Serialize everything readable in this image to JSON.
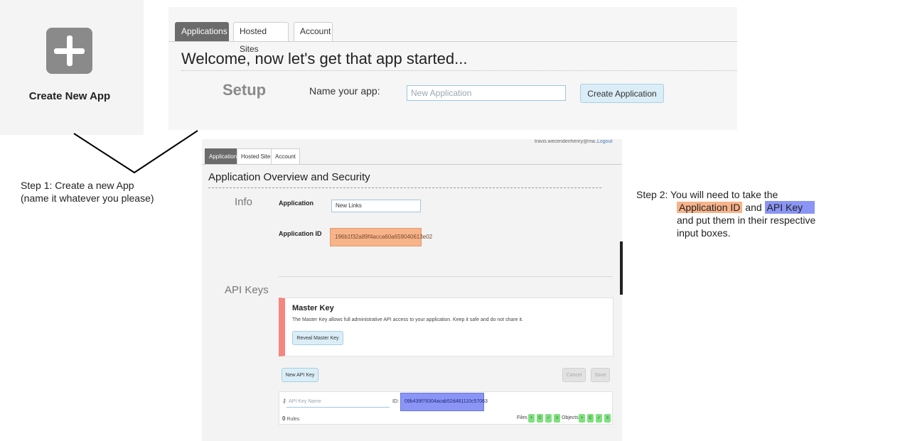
{
  "create_tile": {
    "label": "Create New App",
    "icon": "plus-icon"
  },
  "top_panel": {
    "tabs": [
      "Applications",
      "Hosted Sites",
      "Account"
    ],
    "active_tab": 0,
    "welcome": "Welcome, now let's get that app started...",
    "setup_label": "Setup",
    "name_label": "Name your app:",
    "name_placeholder": "New Application",
    "create_button": "Create Application"
  },
  "step1": {
    "line1": "Step 1: Create a new App",
    "line2": "(name it whatever you please)"
  },
  "step2": {
    "prefix": "Step 2: You will need to take the",
    "app_id": "Application ID",
    "and": "and",
    "api_key": "API Key",
    "line3": "and put them in their respective",
    "line4": "input boxes."
  },
  "second_panel": {
    "user_email": "travis.wecendenhenry@ma...",
    "logout": "Logout",
    "tabs": [
      "Applications",
      "Hosted Sites",
      "Account"
    ],
    "title": "Application Overview and Security",
    "info_label": "Info",
    "application_label": "Application",
    "application_value": "New Links",
    "app_id_label": "Application ID",
    "app_id_value": "196b1f32a89f4acca60a659040613e02",
    "api_keys_label": "API Keys",
    "master_key": {
      "title": "Master Key",
      "desc": "The Master Key allows full administrative API access to your application. Keep it safe and do not share it.",
      "reveal_button": "Reveal Master Key"
    },
    "new_key_button": "New API Key",
    "cancel_button": "Cancel",
    "save_button": "Save",
    "key_row": {
      "name_placeholder": "API Key Name",
      "id_label": "ID:",
      "api_key_value": "09b439f78304acab52d481110c57063",
      "rules_count": "0",
      "rules_label": "Rules",
      "files_label": "Files",
      "objects_label": "Objects",
      "perm_symbols": [
        "+",
        "C",
        "✓",
        "≡"
      ]
    }
  }
}
